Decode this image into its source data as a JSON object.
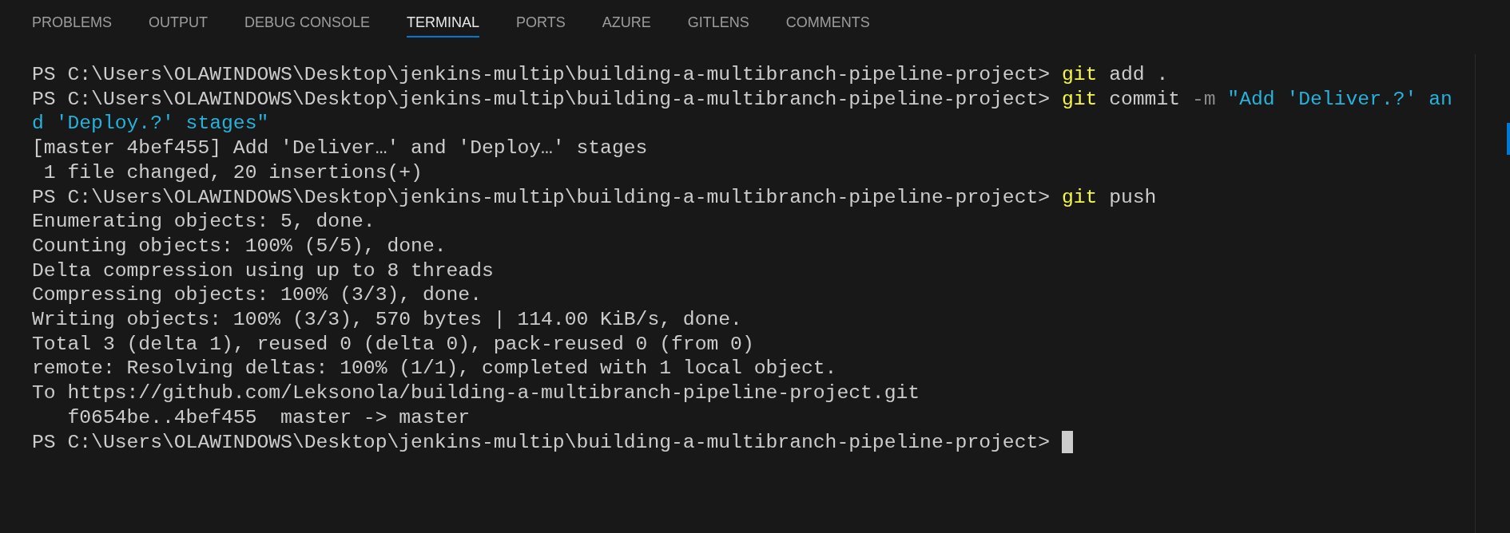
{
  "tabs": [
    {
      "label": "PROBLEMS",
      "selected": false
    },
    {
      "label": "OUTPUT",
      "selected": false
    },
    {
      "label": "DEBUG CONSOLE",
      "selected": false
    },
    {
      "label": "TERMINAL",
      "selected": true
    },
    {
      "label": "PORTS",
      "selected": false
    },
    {
      "label": "AZURE",
      "selected": false
    },
    {
      "label": "GITLENS",
      "selected": false
    },
    {
      "label": "COMMENTS",
      "selected": false
    }
  ],
  "terminal": {
    "lines": [
      [
        {
          "kind": "prompt",
          "text": "PS C:\\Users\\OLAWINDOWS\\Desktop\\jenkins-multip\\building-a-multibranch-pipeline-project> "
        },
        {
          "kind": "command",
          "text": "git"
        },
        {
          "kind": "plain",
          "text": " add ."
        }
      ],
      [
        {
          "kind": "prompt",
          "text": "PS C:\\Users\\OLAWINDOWS\\Desktop\\jenkins-multip\\building-a-multibranch-pipeline-project> "
        },
        {
          "kind": "command",
          "text": "git"
        },
        {
          "kind": "plain",
          "text": " commit "
        },
        {
          "kind": "flag",
          "text": "-m"
        },
        {
          "kind": "string",
          "text": " \"Add 'Deliver.?' an"
        }
      ],
      [
        {
          "kind": "string",
          "text": "d 'Deploy.?' stages\""
        }
      ],
      [
        {
          "kind": "plain",
          "text": "[master 4bef455] Add 'Deliver…' and 'Deploy…' stages"
        }
      ],
      [
        {
          "kind": "plain",
          "text": " 1 file changed, 20 insertions(+)"
        }
      ],
      [
        {
          "kind": "prompt",
          "text": "PS C:\\Users\\OLAWINDOWS\\Desktop\\jenkins-multip\\building-a-multibranch-pipeline-project> "
        },
        {
          "kind": "command",
          "text": "git"
        },
        {
          "kind": "plain",
          "text": " push"
        }
      ],
      [
        {
          "kind": "plain",
          "text": "Enumerating objects: 5, done."
        }
      ],
      [
        {
          "kind": "plain",
          "text": "Counting objects: 100% (5/5), done."
        }
      ],
      [
        {
          "kind": "plain",
          "text": "Delta compression using up to 8 threads"
        }
      ],
      [
        {
          "kind": "plain",
          "text": "Compressing objects: 100% (3/3), done."
        }
      ],
      [
        {
          "kind": "plain",
          "text": "Writing objects: 100% (3/3), 570 bytes | 114.00 KiB/s, done."
        }
      ],
      [
        {
          "kind": "plain",
          "text": "Total 3 (delta 1), reused 0 (delta 0), pack-reused 0 (from 0)"
        }
      ],
      [
        {
          "kind": "plain",
          "text": "remote: Resolving deltas: 100% (1/1), completed with 1 local object."
        }
      ],
      [
        {
          "kind": "plain",
          "text": "To https://github.com/Leksonola/building-a-multibranch-pipeline-project.git"
        }
      ],
      [
        {
          "kind": "plain",
          "text": "   f0654be..4bef455  master -> master"
        }
      ],
      [
        {
          "kind": "prompt",
          "text": "PS C:\\Users\\OLAWINDOWS\\Desktop\\jenkins-multip\\building-a-multibranch-pipeline-project> "
        },
        {
          "kind": "cursor"
        }
      ]
    ]
  }
}
